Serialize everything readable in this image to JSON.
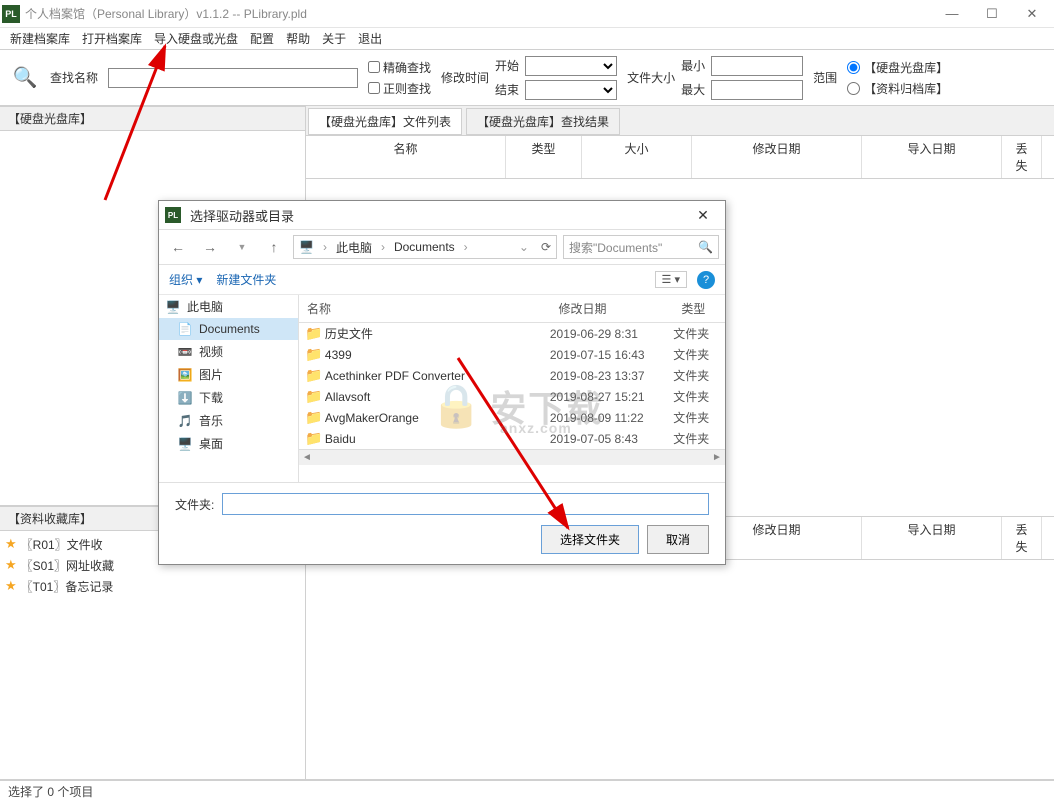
{
  "window": {
    "title": "个人档案馆（Personal Library）v1.1.2 -- PLibrary.pld",
    "icon_text": "PL"
  },
  "menu": [
    "新建档案库",
    "打开档案库",
    "导入硬盘或光盘",
    "配置",
    "帮助",
    "关于",
    "退出"
  ],
  "toolbar": {
    "name_label": "查找名称",
    "exact": "精确查找",
    "regex": "正则查找",
    "mtime": "修改时间",
    "start": "开始",
    "end": "结束",
    "fsize": "文件大小",
    "min": "最小",
    "max": "最大",
    "scope": "范围",
    "radio1": "【硬盘光盘库】",
    "radio2": "【资料归档库】"
  },
  "left_panel1": "【硬盘光盘库】",
  "left_panel2": "【资料收藏库】",
  "tabs": {
    "t1": "【硬盘光盘库】文件列表",
    "t2": "【硬盘光盘库】查找结果"
  },
  "cols": {
    "name": "名称",
    "type": "类型",
    "size": "大小",
    "mdate": "修改日期",
    "idate": "导入日期",
    "lost": "丢失"
  },
  "favorites": [
    {
      "label": "〖R01〗文件收"
    },
    {
      "label": "〖S01〗网址收藏"
    },
    {
      "label": "〖T01〗备忘记录"
    }
  ],
  "status": "选择了 0 个项目",
  "dialog": {
    "title": "选择驱动器或目录",
    "back": "←",
    "fwd": "→",
    "up": "↑",
    "bc1": "此电脑",
    "bc2": "Documents",
    "search_placeholder": "搜索\"Documents\"",
    "organize": "组织",
    "new_folder": "新建文件夹",
    "side": [
      {
        "icon": "🖥️",
        "label": "此电脑",
        "root": true
      },
      {
        "icon": "📄",
        "label": "Documents",
        "sel": true
      },
      {
        "icon": "📼",
        "label": "视频"
      },
      {
        "icon": "🖼️",
        "label": "图片"
      },
      {
        "icon": "⬇️",
        "label": "下载"
      },
      {
        "icon": "🎵",
        "label": "音乐"
      },
      {
        "icon": "🖥️",
        "label": "桌面"
      }
    ],
    "fhdr": {
      "name": "名称",
      "date": "修改日期",
      "type": "类型"
    },
    "files": [
      {
        "name": "历史文件",
        "date": "2019-06-29 8:31",
        "type": "文件夹"
      },
      {
        "name": "4399",
        "date": "2019-07-15 16:43",
        "type": "文件夹"
      },
      {
        "name": "Acethinker PDF Converter",
        "date": "2019-08-23 13:37",
        "type": "文件夹"
      },
      {
        "name": "Allavsoft",
        "date": "2019-08-27 15:21",
        "type": "文件夹"
      },
      {
        "name": "AvgMakerOrange",
        "date": "2019-08-09 11:22",
        "type": "文件夹"
      },
      {
        "name": "Baidu",
        "date": "2019-07-05 8:43",
        "type": "文件夹"
      }
    ],
    "folder_label": "文件夹:",
    "ok": "选择文件夹",
    "cancel": "取消"
  },
  "watermark": {
    "main": "安下载",
    "sub": "anxz.com"
  }
}
